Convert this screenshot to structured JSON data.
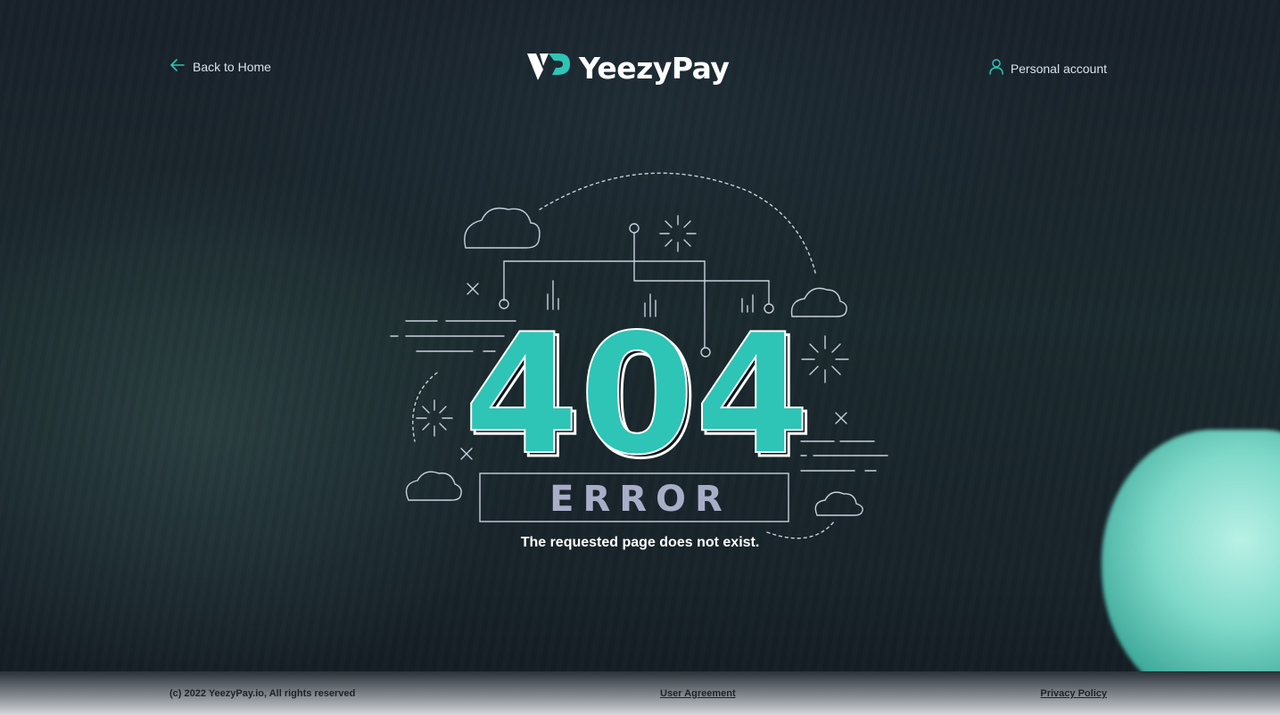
{
  "header": {
    "back_label": "Back to Home",
    "account_label": "Personal account",
    "logo_text": "YeezyPay"
  },
  "hero": {
    "code": "404",
    "error_label": "ERROR",
    "message": "The requested page does not exist."
  },
  "footer": {
    "copyright": "(c) 2022 YeezyPay.io, All rights reserved",
    "user_agreement": "User Agreement",
    "privacy_policy": "Privacy Policy"
  },
  "colors": {
    "accent": "#2ec4b6",
    "background": "#1a2129",
    "line_art": "#c9d0dc",
    "error_text": "#a9aec8"
  },
  "icons": {
    "back": "arrow-left-icon",
    "account": "user-icon",
    "logo": "yeezypay-logo-icon"
  }
}
